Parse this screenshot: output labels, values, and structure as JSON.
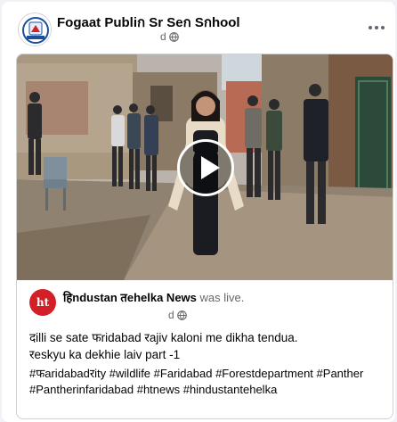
{
  "post": {
    "page_name": "Fogaat Publiก Sr Seก Sกhool",
    "time": "d",
    "more_icon": "more-horizontal-icon",
    "privacy_icon": "globe-icon"
  },
  "shared": {
    "source_name": "हिndustan तehelka News",
    "source_verb": "was live.",
    "source_logo_text": "ht",
    "time": "d",
    "caption_line1": "दilli se sate फridabad रajiv kaloni me dikha tendua.",
    "caption_line2": "रeskyu ka dekhie laiv part -1",
    "hashtags": [
      "#फaridabadरity",
      "#wildlife",
      "#Faridabad",
      "#Forestdepartment",
      "#Panther",
      "#Pantherinfaridabad",
      "#htnews",
      "#hindustantehelka"
    ],
    "colors": {
      "logo": "#d32027",
      "meta": "#65676b"
    }
  },
  "video": {
    "play_icon": "play-icon"
  }
}
